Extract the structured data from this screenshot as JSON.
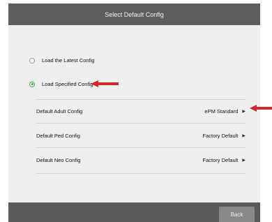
{
  "dialog": {
    "title": "Select Default Config",
    "options": [
      {
        "label": "Load the Latest Config",
        "selected": false
      },
      {
        "label": "Load Specified Config",
        "selected": true
      }
    ],
    "configs": [
      {
        "label": "Default Adult Config",
        "value": "ePM Standard"
      },
      {
        "label": "Default Ped Config",
        "value": "Factory Default"
      },
      {
        "label": "Default Neo Config",
        "value": "Factory Default"
      }
    ],
    "back_label": "Back"
  },
  "icons": {
    "chevron": "chevron-right-icon",
    "annotation_arrow": "red-arrow-icon"
  },
  "colors": {
    "title_bar": "#5d5d5d",
    "background": "#efefef",
    "radio_selected": "#3bb24a",
    "annotation_arrow": "#d0282d"
  }
}
